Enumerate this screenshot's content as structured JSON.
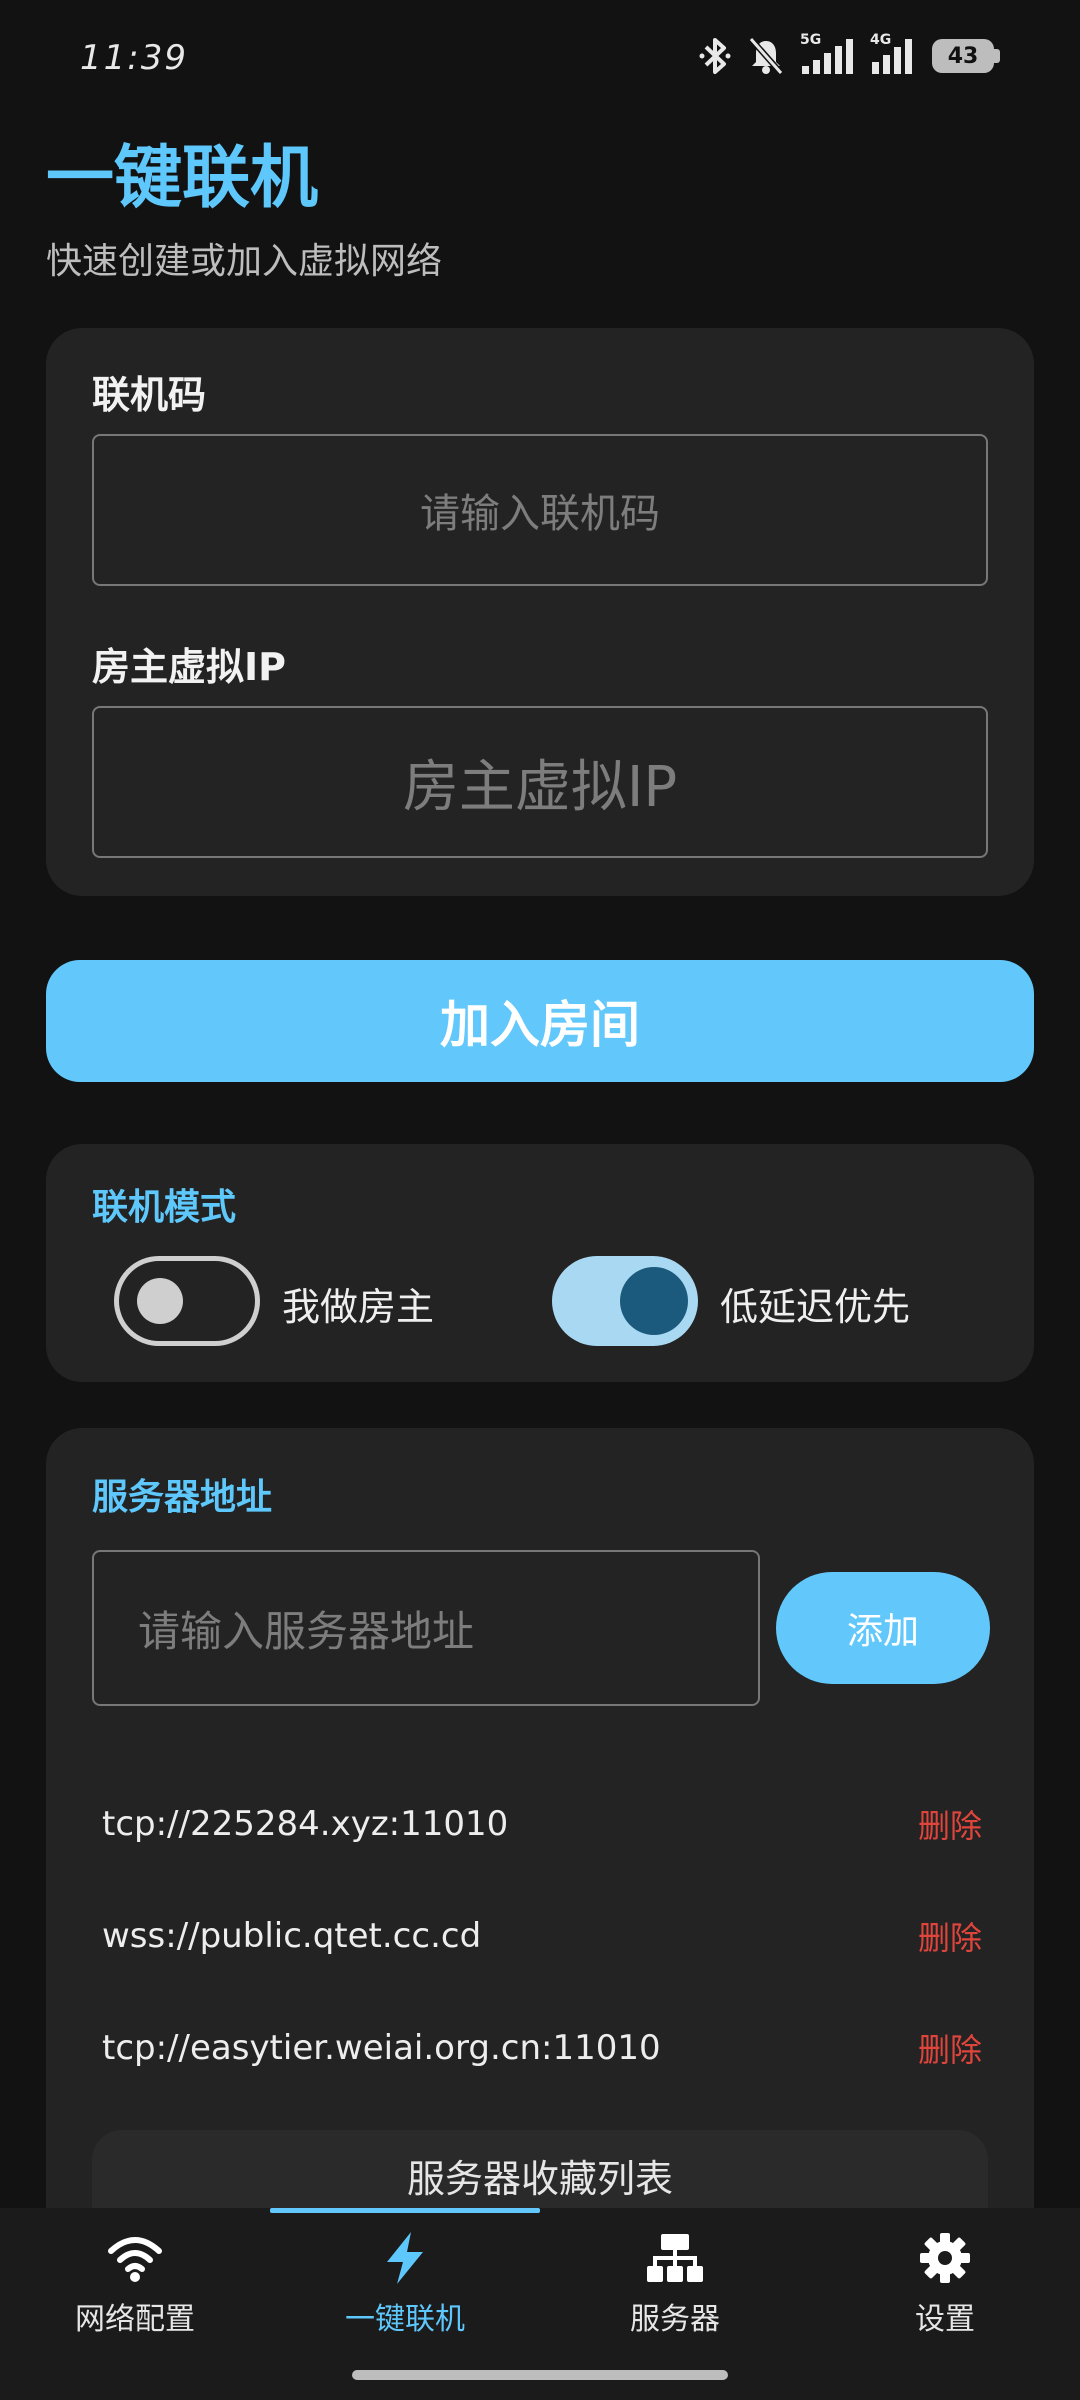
{
  "status_bar": {
    "time": "11:39",
    "network_1": "5G",
    "network_2": "4G",
    "battery": "43",
    "icons": [
      "bluetooth-icon",
      "mute-bell-icon",
      "signal-5g-icon",
      "signal-4g-icon",
      "battery-icon"
    ]
  },
  "header": {
    "title": "一键联机",
    "subtitle": "快速创建或加入虚拟网络"
  },
  "join_card": {
    "code_label": "联机码",
    "code_placeholder": "请输入联机码",
    "host_ip_label": "房主虚拟IP",
    "host_ip_placeholder": "房主虚拟IP"
  },
  "join_button": "加入房间",
  "mode_card": {
    "title": "联机模式",
    "host_toggle": {
      "label": "我做房主",
      "on": false
    },
    "low_latency_toggle": {
      "label": "低延迟优先",
      "on": true
    }
  },
  "server_card": {
    "title": "服务器地址",
    "input_placeholder": "请输入服务器地址",
    "add_label": "添加",
    "delete_label": "删除",
    "servers": [
      "tcp://225284.xyz:11010",
      "wss://public.qtet.cc.cd",
      "tcp://easytier.weiai.org.cn:11010"
    ],
    "favorites_label": "服务器收藏列表"
  },
  "bottom_nav": {
    "items": [
      {
        "label": "网络配置",
        "icon": "wifi-icon"
      },
      {
        "label": "一键联机",
        "icon": "lightning-icon",
        "active": true
      },
      {
        "label": "服务器",
        "icon": "server-network-icon"
      },
      {
        "label": "设置",
        "icon": "gear-icon"
      }
    ]
  },
  "colors": {
    "accent": "#5ec7fb",
    "background": "#121212",
    "card": "#232323",
    "danger": "#e0453c"
  }
}
